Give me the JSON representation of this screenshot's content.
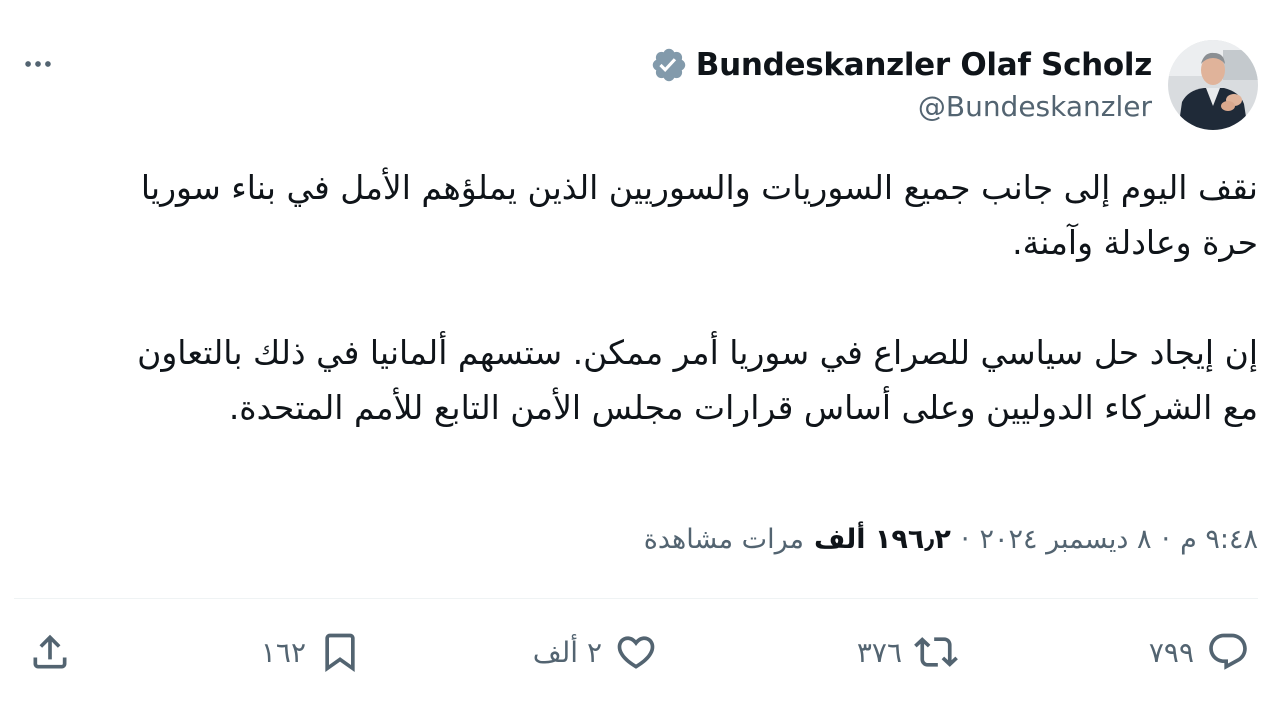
{
  "author": {
    "display_name": "Bundeskanzler Olaf Scholz",
    "handle": "@Bundeskanzler",
    "verified": true
  },
  "tweet": {
    "paragraphs": [
      "نقف اليوم إلى جانب جميع السوريات والسوريين الذين يملؤهم الأمل في بناء سوريا حرة وعادلة وآمنة.",
      "إن إيجاد حل سياسي للصراع في سوريا أمر ممكن. ستسهم ألمانيا في ذلك بالتعاون مع الشركاء الدوليين وعلى أساس قرارات مجلس الأمن التابع للأمم المتحدة."
    ]
  },
  "meta": {
    "time": "٩:٤٨ م",
    "date": "٨ ديسمبر ٢٠٢٤",
    "separator": "·",
    "views_count": "١٩٦٫٢ ألف",
    "views_label": "مرات مشاهدة"
  },
  "actions": {
    "replies": "٧٩٩",
    "retweets": "٣٧٦",
    "likes": "٢ ألف",
    "bookmarks": "١٦٢"
  },
  "icons": {
    "more": "more-horizontal-icon",
    "verified": "verified-badge-icon",
    "reply": "reply-icon",
    "retweet": "retweet-icon",
    "like": "heart-icon",
    "bookmark": "bookmark-icon",
    "share": "share-icon"
  },
  "colors": {
    "text_primary": "#0f1419",
    "text_secondary": "#536471",
    "verified_badge": "#829aab",
    "divider": "#eff3f4"
  }
}
